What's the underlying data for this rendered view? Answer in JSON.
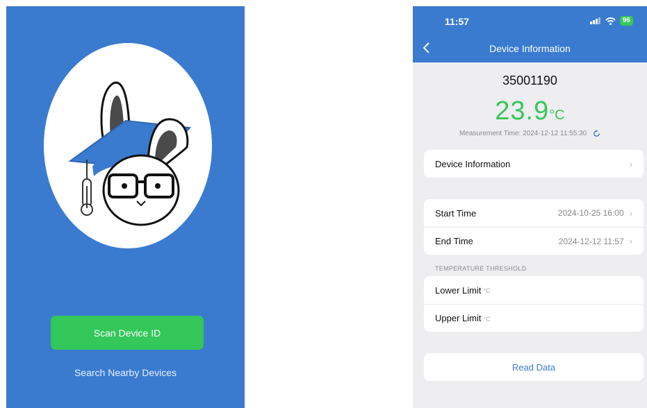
{
  "left_screen": {
    "scan_button_label": "Scan Device ID",
    "search_link_label": "Search Nearby Devices"
  },
  "right_screen": {
    "status_bar": {
      "time": "11:57",
      "battery": "96"
    },
    "nav": {
      "title": "Device Information"
    },
    "device_id": "35001190",
    "temperature": {
      "value": "23.9",
      "unit": "°C"
    },
    "measurement_time": "Measurement Time: 2024-12-12 11:55:30",
    "device_info_row": {
      "label": "Device Information",
      "chevron": "›"
    },
    "time_rows": [
      {
        "label": "Start Time",
        "value": "2024-10-25 16:00",
        "chevron": "›"
      },
      {
        "label": "End Time",
        "value": "2024-12-12 11:57",
        "chevron": "›"
      }
    ],
    "threshold_section": "TEMPERATURE THRESHOLD",
    "threshold_rows": [
      {
        "label": "Lower Limit",
        "unit": "°C"
      },
      {
        "label": "Upper Limit",
        "unit": "°C"
      }
    ],
    "read_button_label": "Read Data"
  },
  "colors": {
    "brand_blue": "#3a7bd0",
    "accent_green": "#34c759",
    "background_gray": "#eeeef1"
  }
}
